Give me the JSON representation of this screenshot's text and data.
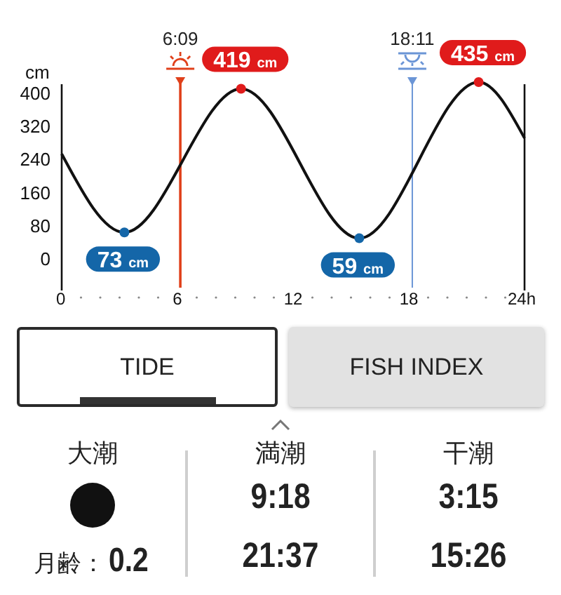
{
  "chart": {
    "chart_data": {
      "type": "line",
      "ylabel": "cm",
      "xlim": [
        0,
        24
      ],
      "ylim": [
        -60,
        440
      ],
      "x": [
        0,
        3.25,
        9.3,
        15.43,
        21.62,
        24
      ],
      "series": [
        {
          "color": "#111111",
          "values": [
            262,
            73,
            419,
            59,
            435,
            300
          ]
        }
      ],
      "xticks": [
        0,
        6,
        12,
        18,
        {
          "value": 24,
          "label": "24h"
        }
      ],
      "yticks": [
        0,
        80,
        160,
        240,
        320,
        400
      ],
      "annotations": [
        {
          "x": 3.25,
          "y": 73,
          "text": "73 cm"
        },
        {
          "x": 9.3,
          "y": 419,
          "text": "419 cm"
        },
        {
          "x": 15.43,
          "y": 59,
          "text": "59 cm"
        },
        {
          "x": 21.62,
          "y": 435,
          "text": "435 cm"
        }
      ],
      "ref_lines": [
        {
          "axis": "x",
          "value": 6.15,
          "label": "6:09",
          "color": "#e0401a"
        },
        {
          "axis": "x",
          "value": 18.18,
          "label": "18:11",
          "color": "#6b95d6"
        }
      ]
    },
    "sun_icons": [
      {
        "kind": "sunrise"
      },
      {
        "kind": "sunset"
      }
    ]
  },
  "tabs": [
    {
      "label": "TIDE",
      "selected": true
    },
    {
      "label": "FISH INDEX",
      "selected": false
    }
  ],
  "summary": {
    "tide_name": "大潮",
    "moon_age_label": "月齢：",
    "moon_age": "0.2",
    "columns": [
      {
        "heading": "満潮",
        "times": [
          "9:18",
          "21:37"
        ]
      },
      {
        "heading": "干潮",
        "times": [
          "3:15",
          "15:26"
        ]
      }
    ]
  }
}
